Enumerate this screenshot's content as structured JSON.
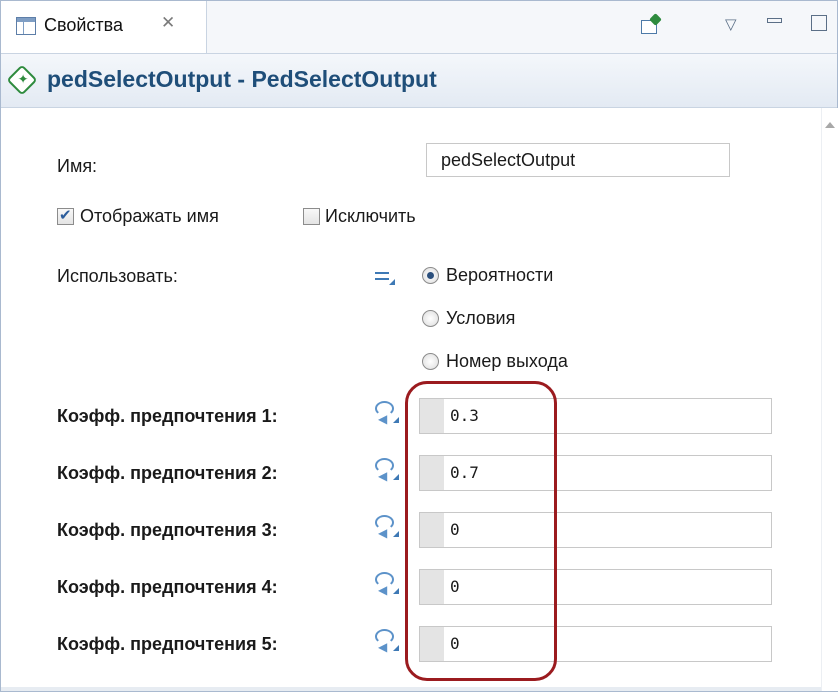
{
  "tab": {
    "label": "Свойства",
    "close_glyph": "✕",
    "icon": "properties-view-icon"
  },
  "toolbar": {
    "pin_icon": "pin-view-icon",
    "menu_glyph": "▽",
    "minimize_icon": "minimize-icon",
    "maximize_icon": "maximize-icon"
  },
  "header": {
    "icon": "ped-select-output-icon",
    "title": "pedSelectOutput - PedSelectOutput",
    "title_color": "#1f4e79"
  },
  "form": {
    "name_label": "Имя:",
    "name_value": "pedSelectOutput",
    "show_name_label": "Отображать имя",
    "show_name_checked": true,
    "exclude_label": "Исключить",
    "exclude_checked": false,
    "use_label": "Использовать:",
    "use_options": [
      {
        "label": "Вероятности",
        "selected": true
      },
      {
        "label": "Условия",
        "selected": false
      },
      {
        "label": "Номер выхода",
        "selected": false
      }
    ],
    "coefficients": [
      {
        "label": "Коэфф. предпочтения 1:",
        "value": "0.3"
      },
      {
        "label": "Коэфф. предпочтения 2:",
        "value": "0.7"
      },
      {
        "label": "Коэфф. предпочтения 3:",
        "value": "0"
      },
      {
        "label": "Коэфф. предпочтения 4:",
        "value": "0"
      },
      {
        "label": "Коэфф. предпочтения 5:",
        "value": "0"
      }
    ]
  },
  "colors": {
    "highlight": "#9b1b1f",
    "accent": "#3e79b5"
  }
}
